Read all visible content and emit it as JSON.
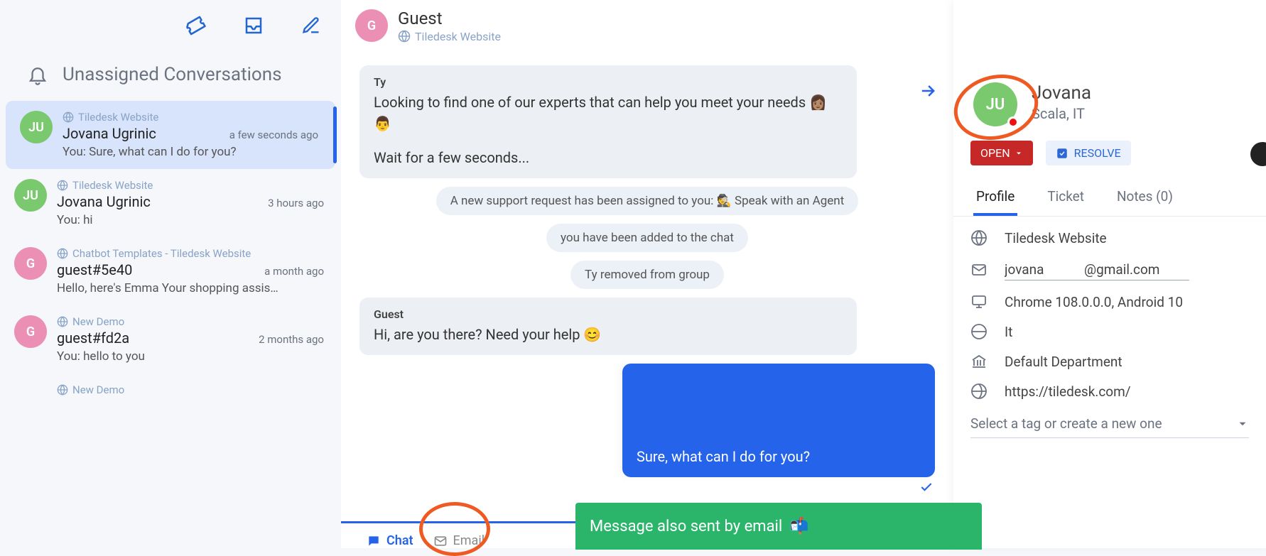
{
  "sidebar": {
    "header": "Unassigned Conversations",
    "items": [
      {
        "source": "Tiledesk Website",
        "name": "Jovana Ugrinic",
        "time": "a few seconds ago",
        "preview": "You: Sure, what can I do for you?",
        "initials": "JU",
        "color": "ju"
      },
      {
        "source": "Tiledesk Website",
        "name": "Jovana Ugrinic",
        "time": "3 hours ago",
        "preview": "You: hi",
        "initials": "JU",
        "color": "ju"
      },
      {
        "source": "Chatbot Templates - Tiledesk Website",
        "name": "guest#5e40",
        "time": "a month ago",
        "preview": "Hello, here's Emma Your shopping assis…",
        "initials": "G",
        "color": "g"
      },
      {
        "source": "New Demo",
        "name": "guest#fd2a",
        "time": "2 months ago",
        "preview": "You: hello to you",
        "initials": "G",
        "color": "g"
      },
      {
        "source": "New Demo",
        "name": "",
        "time": "",
        "preview": "",
        "initials": "",
        "color": ""
      }
    ]
  },
  "chat": {
    "header": {
      "name": "Guest",
      "source": "Tiledesk Website",
      "initials": "G"
    },
    "messages": {
      "ty_sender": "Ty",
      "ty_body_1": "Looking to find one of our experts that can help you meet your needs 👩🏽👨",
      "ty_body_2": "Wait for a few seconds...",
      "sys1": "A new support request has been assigned to you: 🕵️ Speak with an Agent",
      "sys2": "you have been added to the chat",
      "sys3": "Ty removed from group",
      "guest_sender": "Guest",
      "guest_body": "Hi, are you there? Need your help 😊",
      "agent_body": "Sure, what can I do for you?"
    },
    "tabs": {
      "chat": "Chat",
      "email": "Email"
    },
    "toast": "Message also sent by email"
  },
  "profile": {
    "name": "Jovana",
    "location": "Scala, IT",
    "status_open": "OPEN",
    "resolve": "RESOLVE",
    "tabs": {
      "profile": "Profile",
      "ticket": "Ticket",
      "notes": "Notes (0)"
    },
    "fields": {
      "website": "Tiledesk Website",
      "email": "jovana            @gmail.com",
      "browser": "Chrome 108.0.0.0, Android 10",
      "locale": "It",
      "department": "Default Department",
      "url": "https://tiledesk.com/",
      "tag_placeholder": "Select a tag or create a new one"
    }
  }
}
